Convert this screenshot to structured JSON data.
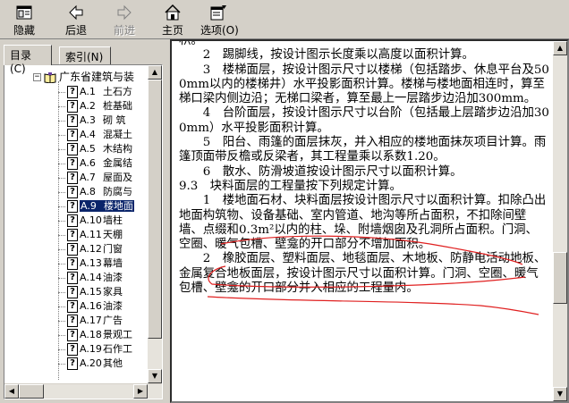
{
  "toolbar": {
    "hide_label": "隐藏",
    "back_label": "后退",
    "forward_label": "前进",
    "home_label": "主页",
    "options_label": "选项(O)"
  },
  "left": {
    "tabs": [
      {
        "label": "目录(C)",
        "active": true
      },
      {
        "label": "索引(N)",
        "active": false
      }
    ],
    "root_label": "广东省建筑与装",
    "items": [
      {
        "code": "A.1",
        "title": "土石方"
      },
      {
        "code": "A.2",
        "title": "桩基础"
      },
      {
        "code": "A.3",
        "title": "砌 筑"
      },
      {
        "code": "A.4",
        "title": "混凝土"
      },
      {
        "code": "A.5",
        "title": "木结构"
      },
      {
        "code": "A.6",
        "title": "金属结"
      },
      {
        "code": "A.7",
        "title": "屋面及"
      },
      {
        "code": "A.8",
        "title": "防腐与"
      },
      {
        "code": "A.9",
        "title": "楼地面",
        "selected": true
      },
      {
        "code": "A.10",
        "title": "墙柱"
      },
      {
        "code": "A.11",
        "title": "天棚"
      },
      {
        "code": "A.12",
        "title": "门窗"
      },
      {
        "code": "A.13",
        "title": "幕墙"
      },
      {
        "code": "A.14",
        "title": "油漆"
      },
      {
        "code": "A.15",
        "title": "家具"
      },
      {
        "code": "A.16",
        "title": "油漆"
      },
      {
        "code": "A.17",
        "title": "广告"
      },
      {
        "code": "A.18",
        "title": "景观工"
      },
      {
        "code": "A.19",
        "title": "石作工"
      },
      {
        "code": "A.20",
        "title": "其他"
      }
    ]
  },
  "doc": {
    "paragraphs": [
      "积。",
      "　　2　踢脚线，按设计图示长度乘以高度以面积计算。",
      "　　3　楼梯面层，按设计图示尺寸以楼梯（包括踏步、休息平台及500mm以内的楼梯井）水平投影面积计算。楼梯与楼地面相连时，算至梯口梁内侧边沿；无梯口梁者，算至最上一层踏步边沿加300mm。",
      "　　4　台阶面层，按设计图示尺寸以台阶（包括最上层踏步边沿加300mm）水平投影面积计算。",
      "　　5　阳台、雨篷的面层抹灰，并入相应的楼地面抹灰项目计算。雨篷顶面带反檐或反梁者，其工程量乘以系数1.20。",
      "　　6　散水、防滑坡道按设计图示尺寸以面积计算。",
      "9.3　块料面层的工程量按下列规定计算。",
      "　　1　楼地面石材、块料面层按设计图示尺寸以面积计算。扣除凸出地面构筑物、设备基础、室内管道、地沟等所占面积，不扣除间壁墙、点缀和0.3m²以内的柱、垛、附墙烟囱及孔洞所占面积。门洞、空圈、暖气包槽、壁龛的开口部分不增加面积。",
      "　　2　橡胶面层、塑料面层、地毯面层、木地板、防静电活动地板、金属复合地板面层，按设计图示尺寸以面积计算。门洞、空圈、暖气包槽、壁龛的开口部分并入相应的工程量内。"
    ]
  },
  "colors": {
    "selection": "#0a246a",
    "annotation": "#e02020",
    "chrome": "#d4d0c8"
  }
}
